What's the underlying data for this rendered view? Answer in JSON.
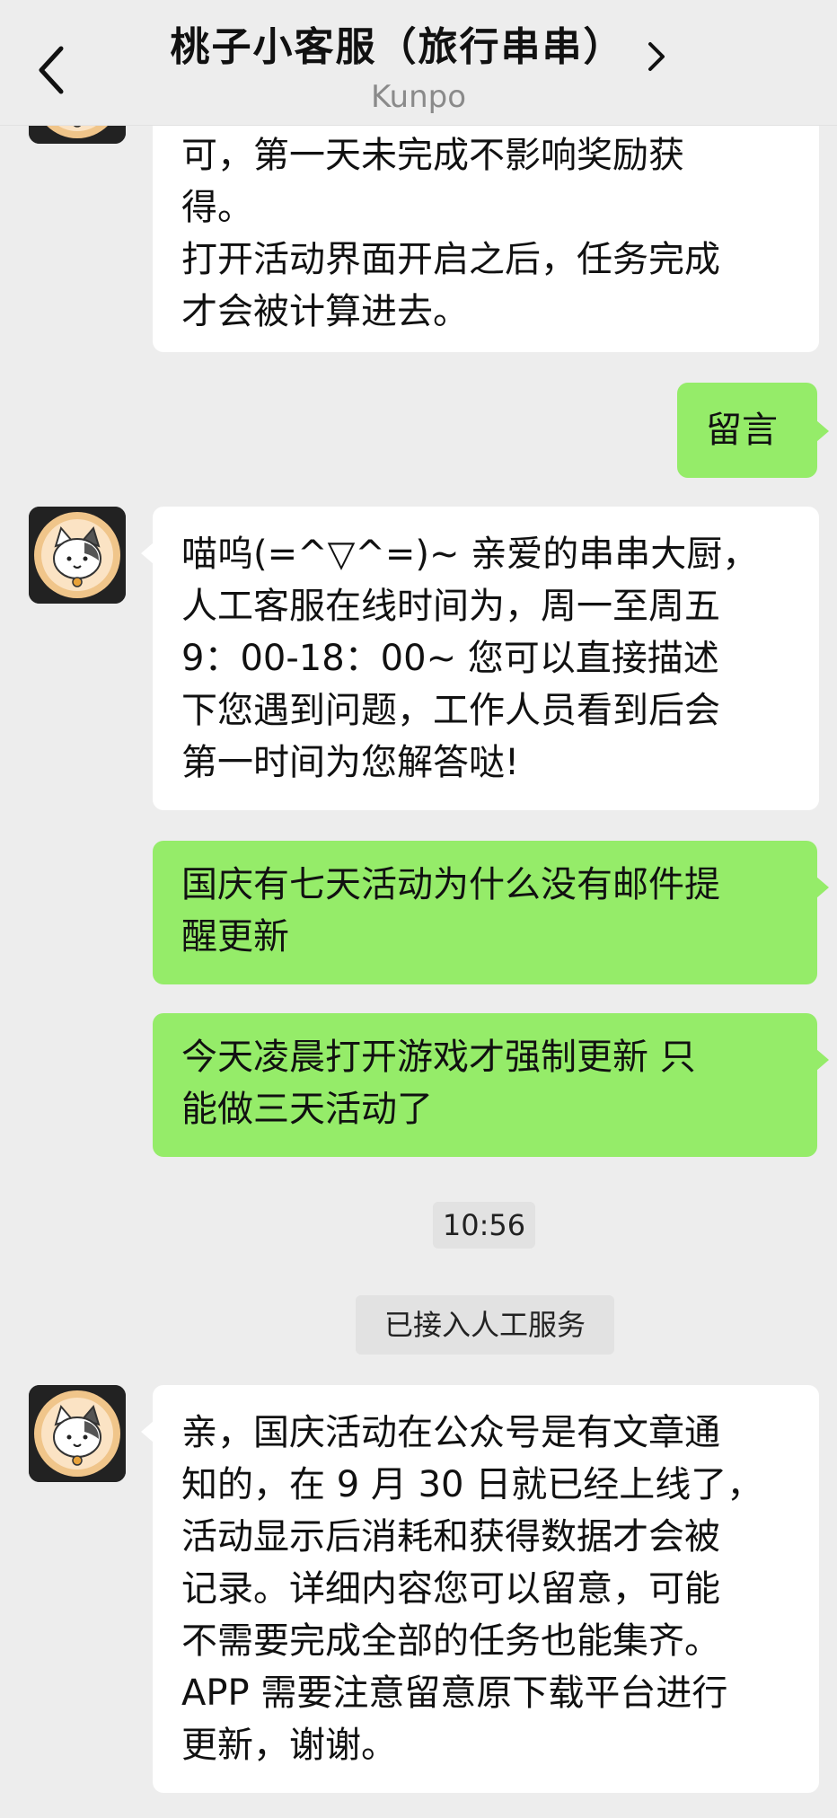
{
  "header": {
    "title": "桃子小客服（旅行串串）",
    "subtitle": "Kunpo"
  },
  "messages": [
    {
      "id": "m1",
      "direction": "in",
      "lines": [
        "可，第一天未完成不影响奖励获",
        "得。",
        "打开活动界面开启之后，任务完成",
        "才会被计算进去。"
      ]
    },
    {
      "id": "m2",
      "direction": "out",
      "lines": [
        "留言"
      ]
    },
    {
      "id": "m3",
      "direction": "in",
      "lines": [
        "喵呜(=^▽^=)~ 亲爱的串串大厨，",
        "人工客服在线时间为，周一至周五",
        "9：00-18：00~ 您可以直接描述",
        "下您遇到问题，工作人员看到后会",
        "第一时间为您解答哒!"
      ]
    },
    {
      "id": "m4",
      "direction": "out",
      "lines": [
        "国庆有七天活动为什么没有邮件提",
        "醒更新"
      ]
    },
    {
      "id": "m5",
      "direction": "out",
      "lines": [
        "今天凌晨打开游戏才强制更新 只",
        "能做三天活动了"
      ]
    },
    {
      "id": "m6",
      "direction": "in",
      "lines": [
        "亲，国庆活动在公众号是有文章通",
        "知的，在 9 月 30 日就已经上线了，",
        "活动显示后消耗和获得数据才会被",
        "记录。详细内容您可以留意，可能",
        "不需要完成全部的任务也能集齐。",
        "APP 需要注意留意原下载平台进行",
        "更新，谢谢。"
      ]
    }
  ],
  "system": {
    "timestamp": "10:56",
    "notice": "已接入人工服务"
  },
  "colors": {
    "background": "#ededed",
    "incoming_bubble": "#ffffff",
    "outgoing_bubble": "#95ec69"
  },
  "icons": {
    "back": "chevron-left-icon",
    "profile": "chevron-right-icon",
    "avatar": "cat-avatar"
  }
}
